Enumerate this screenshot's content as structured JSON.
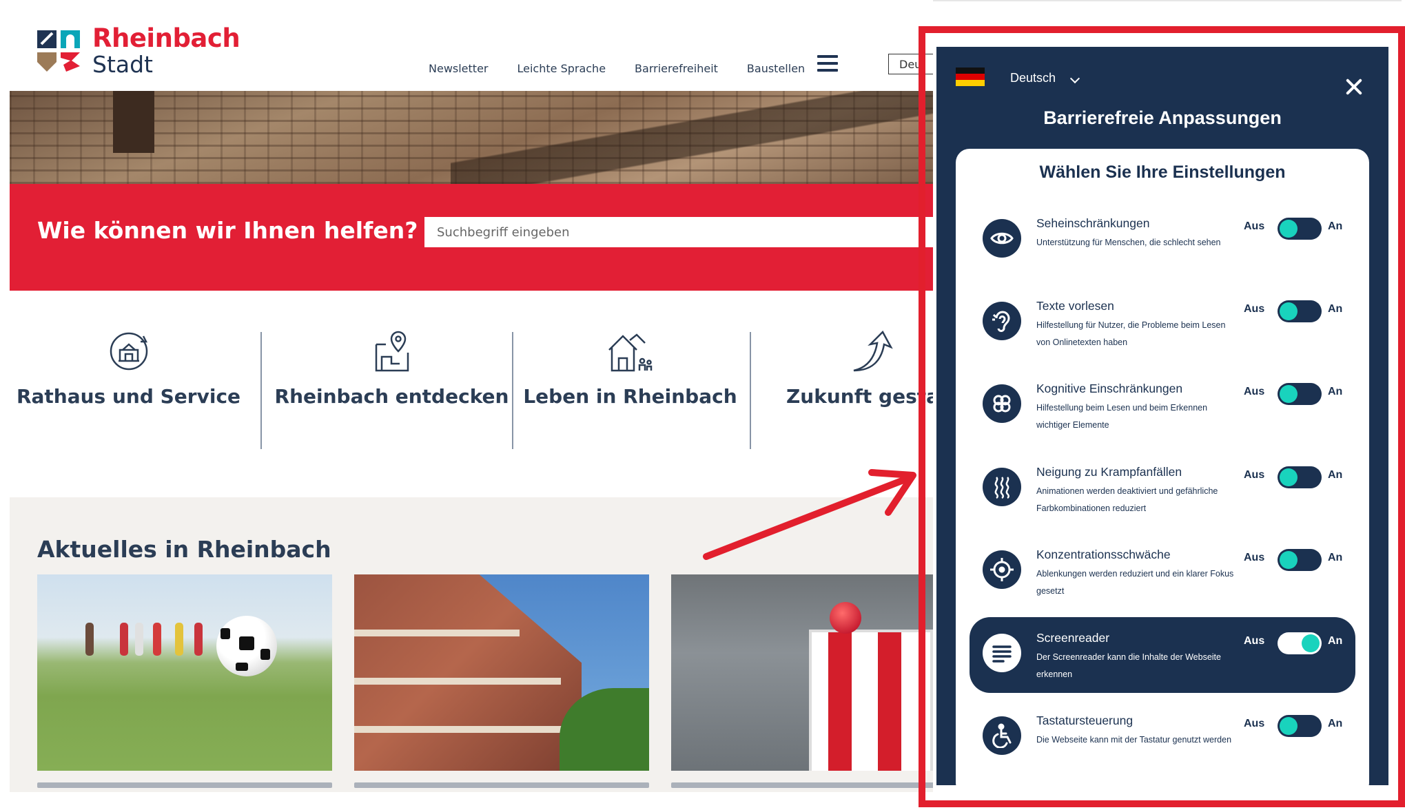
{
  "site": {
    "logo": {
      "title": "Rheinbach",
      "subtitle": "Stadt"
    },
    "nav": [
      "Newsletter",
      "Leichte Sprache",
      "Barrierefreiheit",
      "Baustellen"
    ],
    "language_box": "Deu",
    "search": {
      "heading": "Wie können wir Ihnen helfen?",
      "placeholder": "Suchbegriff eingeben"
    },
    "tiles": [
      {
        "label": "Rathaus und Service",
        "icon": "town-hall-service-icon"
      },
      {
        "label": "Rheinbach entdecken",
        "icon": "map-pin-icon"
      },
      {
        "label": "Leben in Rheinbach",
        "icon": "house-family-icon"
      },
      {
        "label": "Zukunft gestalt",
        "icon": "arrow-up-icon"
      }
    ],
    "news": {
      "heading": "Aktuelles in Rheinbach"
    }
  },
  "panel": {
    "language": "Deutsch",
    "title": "Barrierefreie Anpassungen",
    "subtitle": "Wählen Sie Ihre Einstellungen",
    "off_label": "Aus",
    "on_label": "An",
    "options": [
      {
        "title": "Seheinschränkungen",
        "desc": "Unterstützung für Menschen, die schlecht sehen",
        "icon": "eye-icon",
        "on": false
      },
      {
        "title": "Texte vorlesen",
        "desc": "Hilfestellung für Nutzer, die Probleme beim Lesen von Onlinetexten haben",
        "icon": "ear-icon",
        "on": false
      },
      {
        "title": "Kognitive Einschränkungen",
        "desc": "Hilfestellung beim Lesen und beim Erkennen wichtiger Elemente",
        "icon": "brain-icon",
        "on": false
      },
      {
        "title": "Neigung zu Krampfanfällen",
        "desc": "Animationen werden deaktiviert und gefährliche Farbkombinationen reduziert",
        "icon": "waves-icon",
        "on": false
      },
      {
        "title": "Konzentrationsschwäche",
        "desc": "Ablenkungen werden reduziert und ein klarer Fokus gesetzt",
        "icon": "target-icon",
        "on": false
      },
      {
        "title": "Screenreader",
        "desc": "Der Screenreader kann die Inhalte der Webseite erkennen",
        "icon": "text-lines-icon",
        "on": true
      },
      {
        "title": "Tastatursteuerung",
        "desc": "Die Webseite kann mit der Tastatur genutzt werden",
        "icon": "wheelchair-icon",
        "on": false
      }
    ]
  },
  "colors": {
    "brand_red": "#e21f35",
    "navy": "#1b3150",
    "toggle_teal": "#19d3bd"
  }
}
